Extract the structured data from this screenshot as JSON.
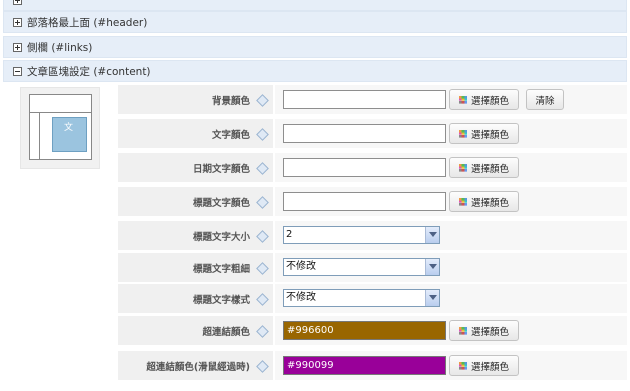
{
  "sections": {
    "top": "",
    "header": "部落格最上面 (#header)",
    "links": "側欄 (#links)",
    "content": "文章區塊設定 (#content)"
  },
  "preview": {
    "content_char": "文"
  },
  "buttons": {
    "pick_color": "選擇顏色",
    "clear": "清除"
  },
  "rows": [
    {
      "label": "背景顏色",
      "value": ""
    },
    {
      "label": "文字顏色",
      "value": ""
    },
    {
      "label": "日期文字顏色",
      "value": ""
    },
    {
      "label": "標題文字顏色",
      "value": ""
    },
    {
      "label": "標題文字大小",
      "value": "2"
    },
    {
      "label": "標題文字粗細",
      "value": "不修改"
    },
    {
      "label": "標題文字樣式",
      "value": "不修改"
    },
    {
      "label": "超連結顏色",
      "value": "#996600",
      "color": "#996600"
    },
    {
      "label": "超連結顏色(滑鼠經過時)",
      "value": "#990099",
      "color": "#990099"
    }
  ]
}
